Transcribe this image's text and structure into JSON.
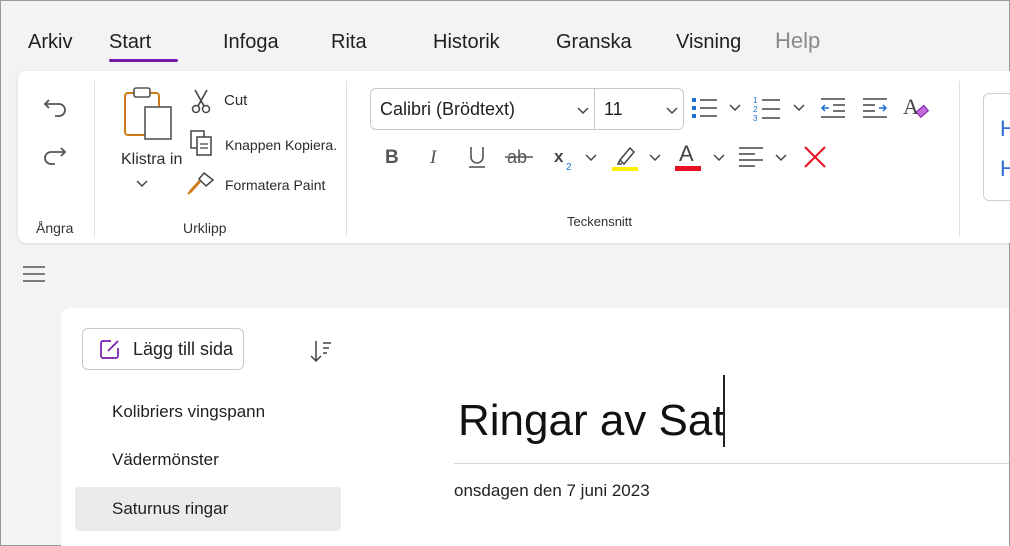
{
  "menu": {
    "tabs": [
      "Arkiv",
      "Start",
      "Infoga",
      "Rita",
      "Historik",
      "Granska",
      "Visning",
      "Help"
    ],
    "active": "Start"
  },
  "ribbon": {
    "undo_group": {
      "label": "Ångra"
    },
    "clipboard": {
      "label": "Urklipp",
      "paste_label": "Klistra in",
      "cut_label": "Cut",
      "copy_label": "Knappen Kopiera.",
      "format_painter_label": "Formatera Paint"
    },
    "font": {
      "label": "Teckensnitt",
      "font_name": "Calibri (Brödtext)",
      "font_size": "11"
    },
    "styles_preview": [
      "H",
      "H"
    ],
    "colors": {
      "highlight": "#ffee00",
      "font_color": "#e81123",
      "clear_format": "#e81123",
      "accent": "#7719aa"
    }
  },
  "page_panel": {
    "add_page_label": "Lägg till sida",
    "pages": [
      {
        "title": "Kolibriers vingspann"
      },
      {
        "title": "Vädermönster"
      },
      {
        "title": "Saturnus ringar"
      }
    ],
    "selected": "Saturnus ringar"
  },
  "canvas": {
    "title": "Ringar av Sat",
    "date": "onsdagen den 7 juni 2023"
  }
}
